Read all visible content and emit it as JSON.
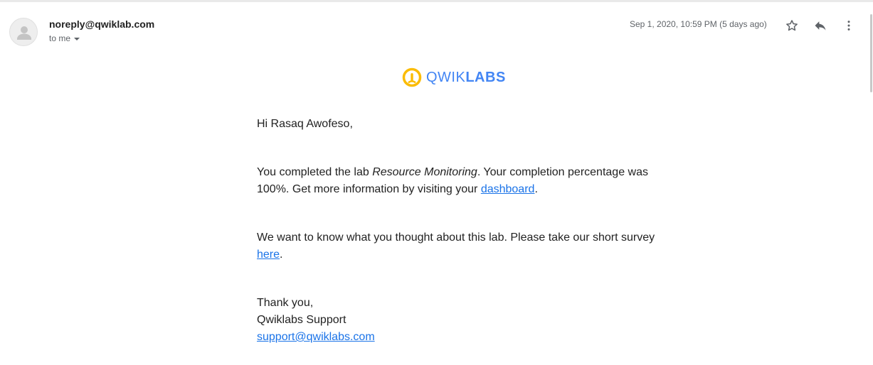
{
  "header": {
    "sender": "noreply@qwiklab.com",
    "recipient": "to me",
    "date": "Sep 1, 2020, 10:59 PM (5 days ago)",
    "icons": [
      "avatar-icon",
      "caret-down-icon",
      "star-icon",
      "reply-icon",
      "more-vert-icon"
    ]
  },
  "logo": {
    "text_light": "QWIK",
    "text_bold": "LABS",
    "colors": {
      "ring": "#fbbc04",
      "text": "#4285f4"
    }
  },
  "message": {
    "greeting": "Hi Rasaq Awofeso,",
    "para1_pre": "You completed the lab ",
    "para1_lab": "Resource Monitoring",
    "para1_mid": ". Your completion percentage was 100%. Get more information by visiting your ",
    "para1_link": "dashboard",
    "para1_end": ".",
    "para2_pre": "We want to know what you thought about this lab. Please take our short survey ",
    "para2_link": "here",
    "para2_end": ".",
    "signoff": "Thank you,",
    "signature": "Qwiklabs Support",
    "support_email": "support@qwiklabs.com"
  },
  "colors": {
    "link": "#1a73e8",
    "muted": "#5f6368"
  }
}
